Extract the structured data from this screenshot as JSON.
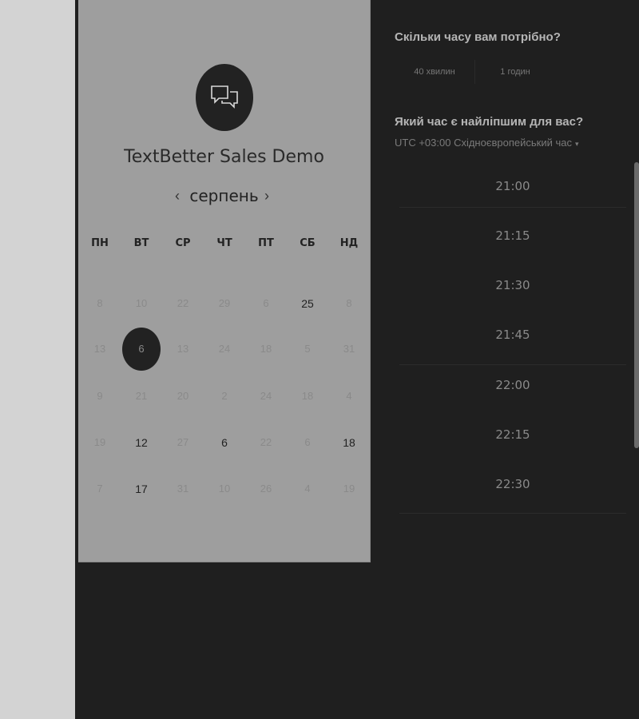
{
  "calendar": {
    "title": "TextBetter Sales Demo",
    "month": "серпень",
    "prev_icon": "‹",
    "next_icon": "›",
    "weekdays": [
      "ПН",
      "ВТ",
      "СР",
      "ЧТ",
      "ПТ",
      "СБ",
      "НД"
    ],
    "weeks": [
      [
        {
          "d": "8"
        },
        {
          "d": "10"
        },
        {
          "d": "22"
        },
        {
          "d": "29"
        },
        {
          "d": "6"
        },
        {
          "d": "25",
          "active": true
        },
        {
          "d": "8"
        }
      ],
      [
        {
          "d": "13"
        },
        {
          "d": "6",
          "selected": true
        },
        {
          "d": "13"
        },
        {
          "d": "24"
        },
        {
          "d": "18"
        },
        {
          "d": "5"
        },
        {
          "d": "31"
        }
      ],
      [
        {
          "d": "9"
        },
        {
          "d": "21"
        },
        {
          "d": "20"
        },
        {
          "d": "2"
        },
        {
          "d": "24"
        },
        {
          "d": "18"
        },
        {
          "d": "4"
        }
      ],
      [
        {
          "d": "19"
        },
        {
          "d": "12",
          "active": true
        },
        {
          "d": "27"
        },
        {
          "d": "6",
          "active": true
        },
        {
          "d": "22"
        },
        {
          "d": "6"
        },
        {
          "d": "18",
          "active": true
        }
      ],
      [
        {
          "d": "7"
        },
        {
          "d": "17",
          "active": true
        },
        {
          "d": "31"
        },
        {
          "d": "10"
        },
        {
          "d": "26"
        },
        {
          "d": "4"
        },
        {
          "d": "19"
        }
      ]
    ]
  },
  "duration": {
    "question": "Скільки часу вам потрібно?",
    "options": [
      "40 хвилин",
      "1 годин"
    ]
  },
  "time": {
    "question": "Який час є найліпшим для вас?",
    "timezone": "UTC +03:00 Східноєвропейський час",
    "timezone_caret": "▾",
    "slots": [
      "21:00",
      "21:15",
      "21:30",
      "21:45",
      "22:00",
      "22:15",
      "22:30"
    ]
  }
}
